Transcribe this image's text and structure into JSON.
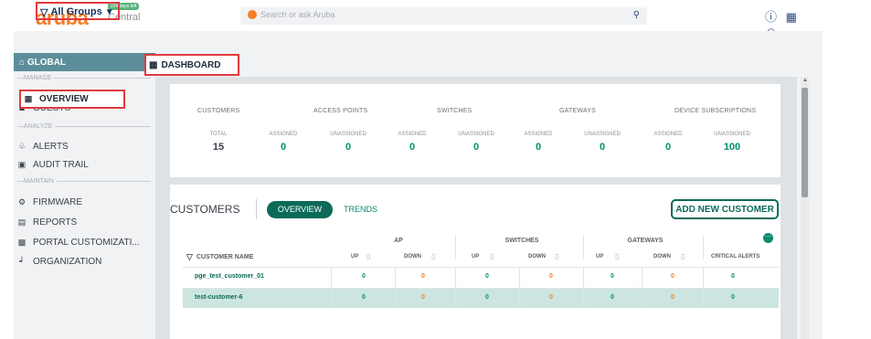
{
  "brand": {
    "name": "aruba",
    "product": "Central",
    "trial_badge": "224 days left"
  },
  "search": {
    "placeholder": "Search or ask Aruba"
  },
  "group_selector": {
    "label": "All Groups"
  },
  "sidebar": {
    "global_label": "GLOBAL",
    "sections": [
      {
        "label": "MANAGE",
        "items": [
          {
            "label": "OVERVIEW",
            "icon": "grid-icon",
            "active": true
          },
          {
            "label": "GUESTS",
            "icon": "users-icon"
          }
        ]
      },
      {
        "label": "ANALYZE",
        "items": [
          {
            "label": "ALERTS",
            "icon": "bell-icon"
          },
          {
            "label": "AUDIT TRAIL",
            "icon": "audit-icon"
          }
        ]
      },
      {
        "label": "MAINTAIN",
        "items": [
          {
            "label": "FIRMWARE",
            "icon": "gear-icon"
          },
          {
            "label": "REPORTS",
            "icon": "report-icon"
          },
          {
            "label": "PORTAL CUSTOMIZATI...",
            "icon": "portal-icon"
          },
          {
            "label": "ORGANIZATION",
            "icon": "org-icon"
          }
        ]
      }
    ]
  },
  "dashboard_tab": {
    "label": "DASHBOARD"
  },
  "summary": {
    "headers": [
      "CUSTOMERS",
      "ACCESS POINTS",
      "SWITCHES",
      "GATEWAYS",
      "DEVICE SUBSCRIPTIONS"
    ],
    "cells": [
      {
        "label": "TOTAL",
        "value": "15"
      },
      {
        "label": "ASSIGNED",
        "value": "0"
      },
      {
        "label": "UNASSIGNED",
        "value": "0"
      },
      {
        "label": "ASSIGNED",
        "value": "0"
      },
      {
        "label": "UNASSIGNED",
        "value": "0"
      },
      {
        "label": "ASSIGNED",
        "value": "0"
      },
      {
        "label": "UNASSIGNED",
        "value": "0"
      },
      {
        "label": "ASSIGNED",
        "value": "0"
      },
      {
        "label": "UNASSIGNED",
        "value": "100"
      }
    ]
  },
  "customers": {
    "title": "CUSTOMERS",
    "tabs": [
      "OVERVIEW",
      "TRENDS"
    ],
    "add_button": "ADD NEW CUSTOMER",
    "group_headers": [
      "AP",
      "SWITCHES",
      "GATEWAYS"
    ],
    "columns": [
      "CUSTOMER NAME",
      "UP",
      "DOWN",
      "UP",
      "DOWN",
      "UP",
      "DOWN",
      "CRITICAL ALERTS"
    ],
    "rows": [
      {
        "name": "pge_test_customer_01",
        "values": [
          "0",
          "0",
          "0",
          "0",
          "0",
          "0",
          "0"
        ]
      },
      {
        "name": "test-customer-6",
        "values": [
          "0",
          "0",
          "0",
          "0",
          "0",
          "0",
          "0"
        ]
      }
    ]
  },
  "colors": {
    "brand_orange": "#f47f28",
    "accent_green": "#0b6b58",
    "highlight_red": "#e03a3e",
    "sidebar_global": "#5c8e9a"
  }
}
